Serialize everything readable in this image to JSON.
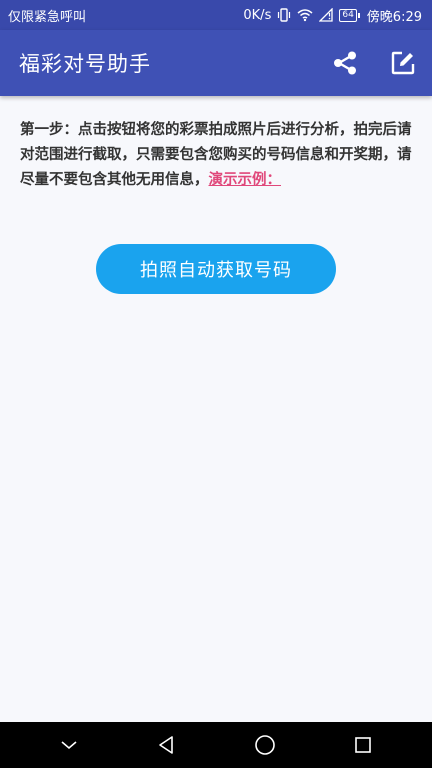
{
  "status_bar": {
    "carrier_text": "仅限紧急呼叫",
    "network_speed": "0K/s",
    "battery_level": "64",
    "time": "傍晚6:29"
  },
  "app_bar": {
    "title": "福彩对号助手",
    "share_icon": "share-icon",
    "edit_icon": "edit-icon"
  },
  "main": {
    "instructions": "第一步：点击按钮将您的彩票拍成照片后进行分析，拍完后请对范围进行截取，只需要包含您购买的号码信息和开奖期，请尽量不要包含其他无用信息，",
    "example_link": "演示示例：",
    "capture_button": "拍照自动获取号码"
  },
  "nav_bar": {
    "back_icon": "back-triangle-icon",
    "home_icon": "home-circle-icon",
    "recents_icon": "recents-square-icon",
    "collapse_icon": "chevron-down-icon"
  },
  "colors": {
    "status_bar": "#3949ab",
    "app_bar": "#3f51b5",
    "button": "#1aa3ee",
    "link": "#e0477a"
  }
}
